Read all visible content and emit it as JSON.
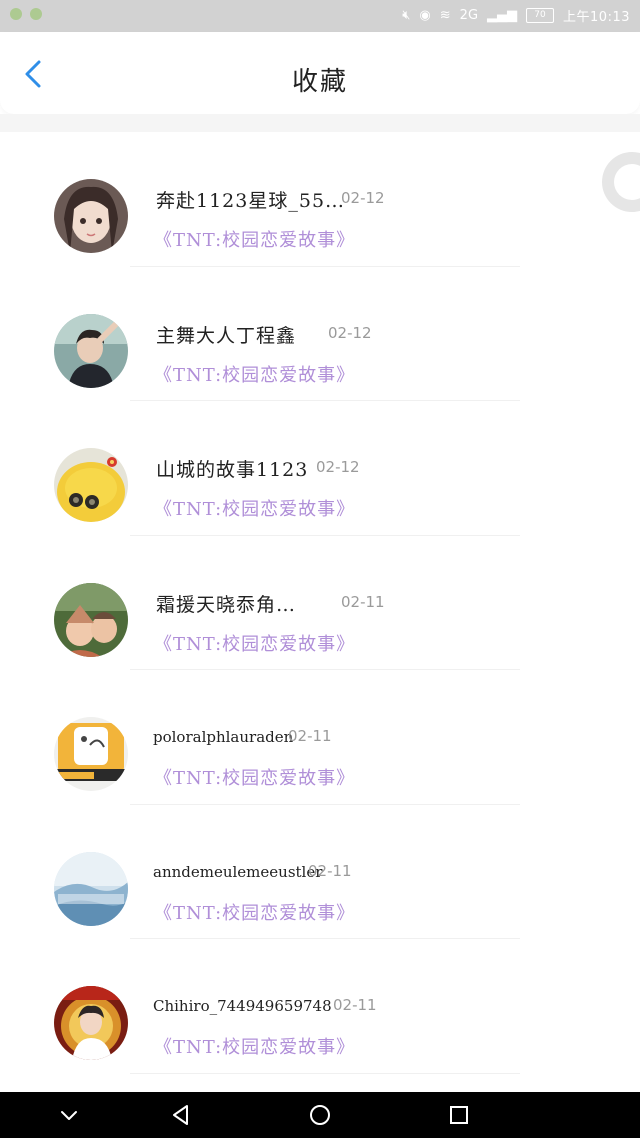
{
  "status_bar": {
    "time": "上午10:13",
    "battery": "70",
    "network": "2G"
  },
  "header": {
    "title": "收藏"
  },
  "items": [
    {
      "name": "奔赴1123星球_55…",
      "date": "02-12",
      "story": "《TNT:校园恋爱故事》",
      "avatar": "girl-portrait"
    },
    {
      "name": "主舞大人丁程鑫",
      "date": "02-12",
      "story": "《TNT:校园恋爱故事》",
      "avatar": "boy-portrait"
    },
    {
      "name": "山城的故事1123",
      "date": "02-12",
      "story": "《TNT:校园恋爱故事》",
      "avatar": "yellow-duck"
    },
    {
      "name": "霜援天晓忝角…",
      "date": "02-11",
      "story": "《TNT:校园恋爱故事》",
      "avatar": "kids-photo"
    },
    {
      "name": "poloralphlauraden",
      "date": "02-11",
      "story": "《TNT:校园恋爱故事》",
      "avatar": "cancer-sticker"
    },
    {
      "name": "anndemeulemeeustler",
      "date": "02-11",
      "story": "《TNT:校园恋爱故事》",
      "avatar": "snow-landscape"
    },
    {
      "name": "Chihiro_744949659748",
      "date": "02-11",
      "story": "《TNT:校园恋爱故事》",
      "avatar": "idol-poster"
    }
  ],
  "colors": {
    "accent_back": "#2f8ee8",
    "story_text": "#b08fd8",
    "date_text": "#9a9a9a"
  }
}
